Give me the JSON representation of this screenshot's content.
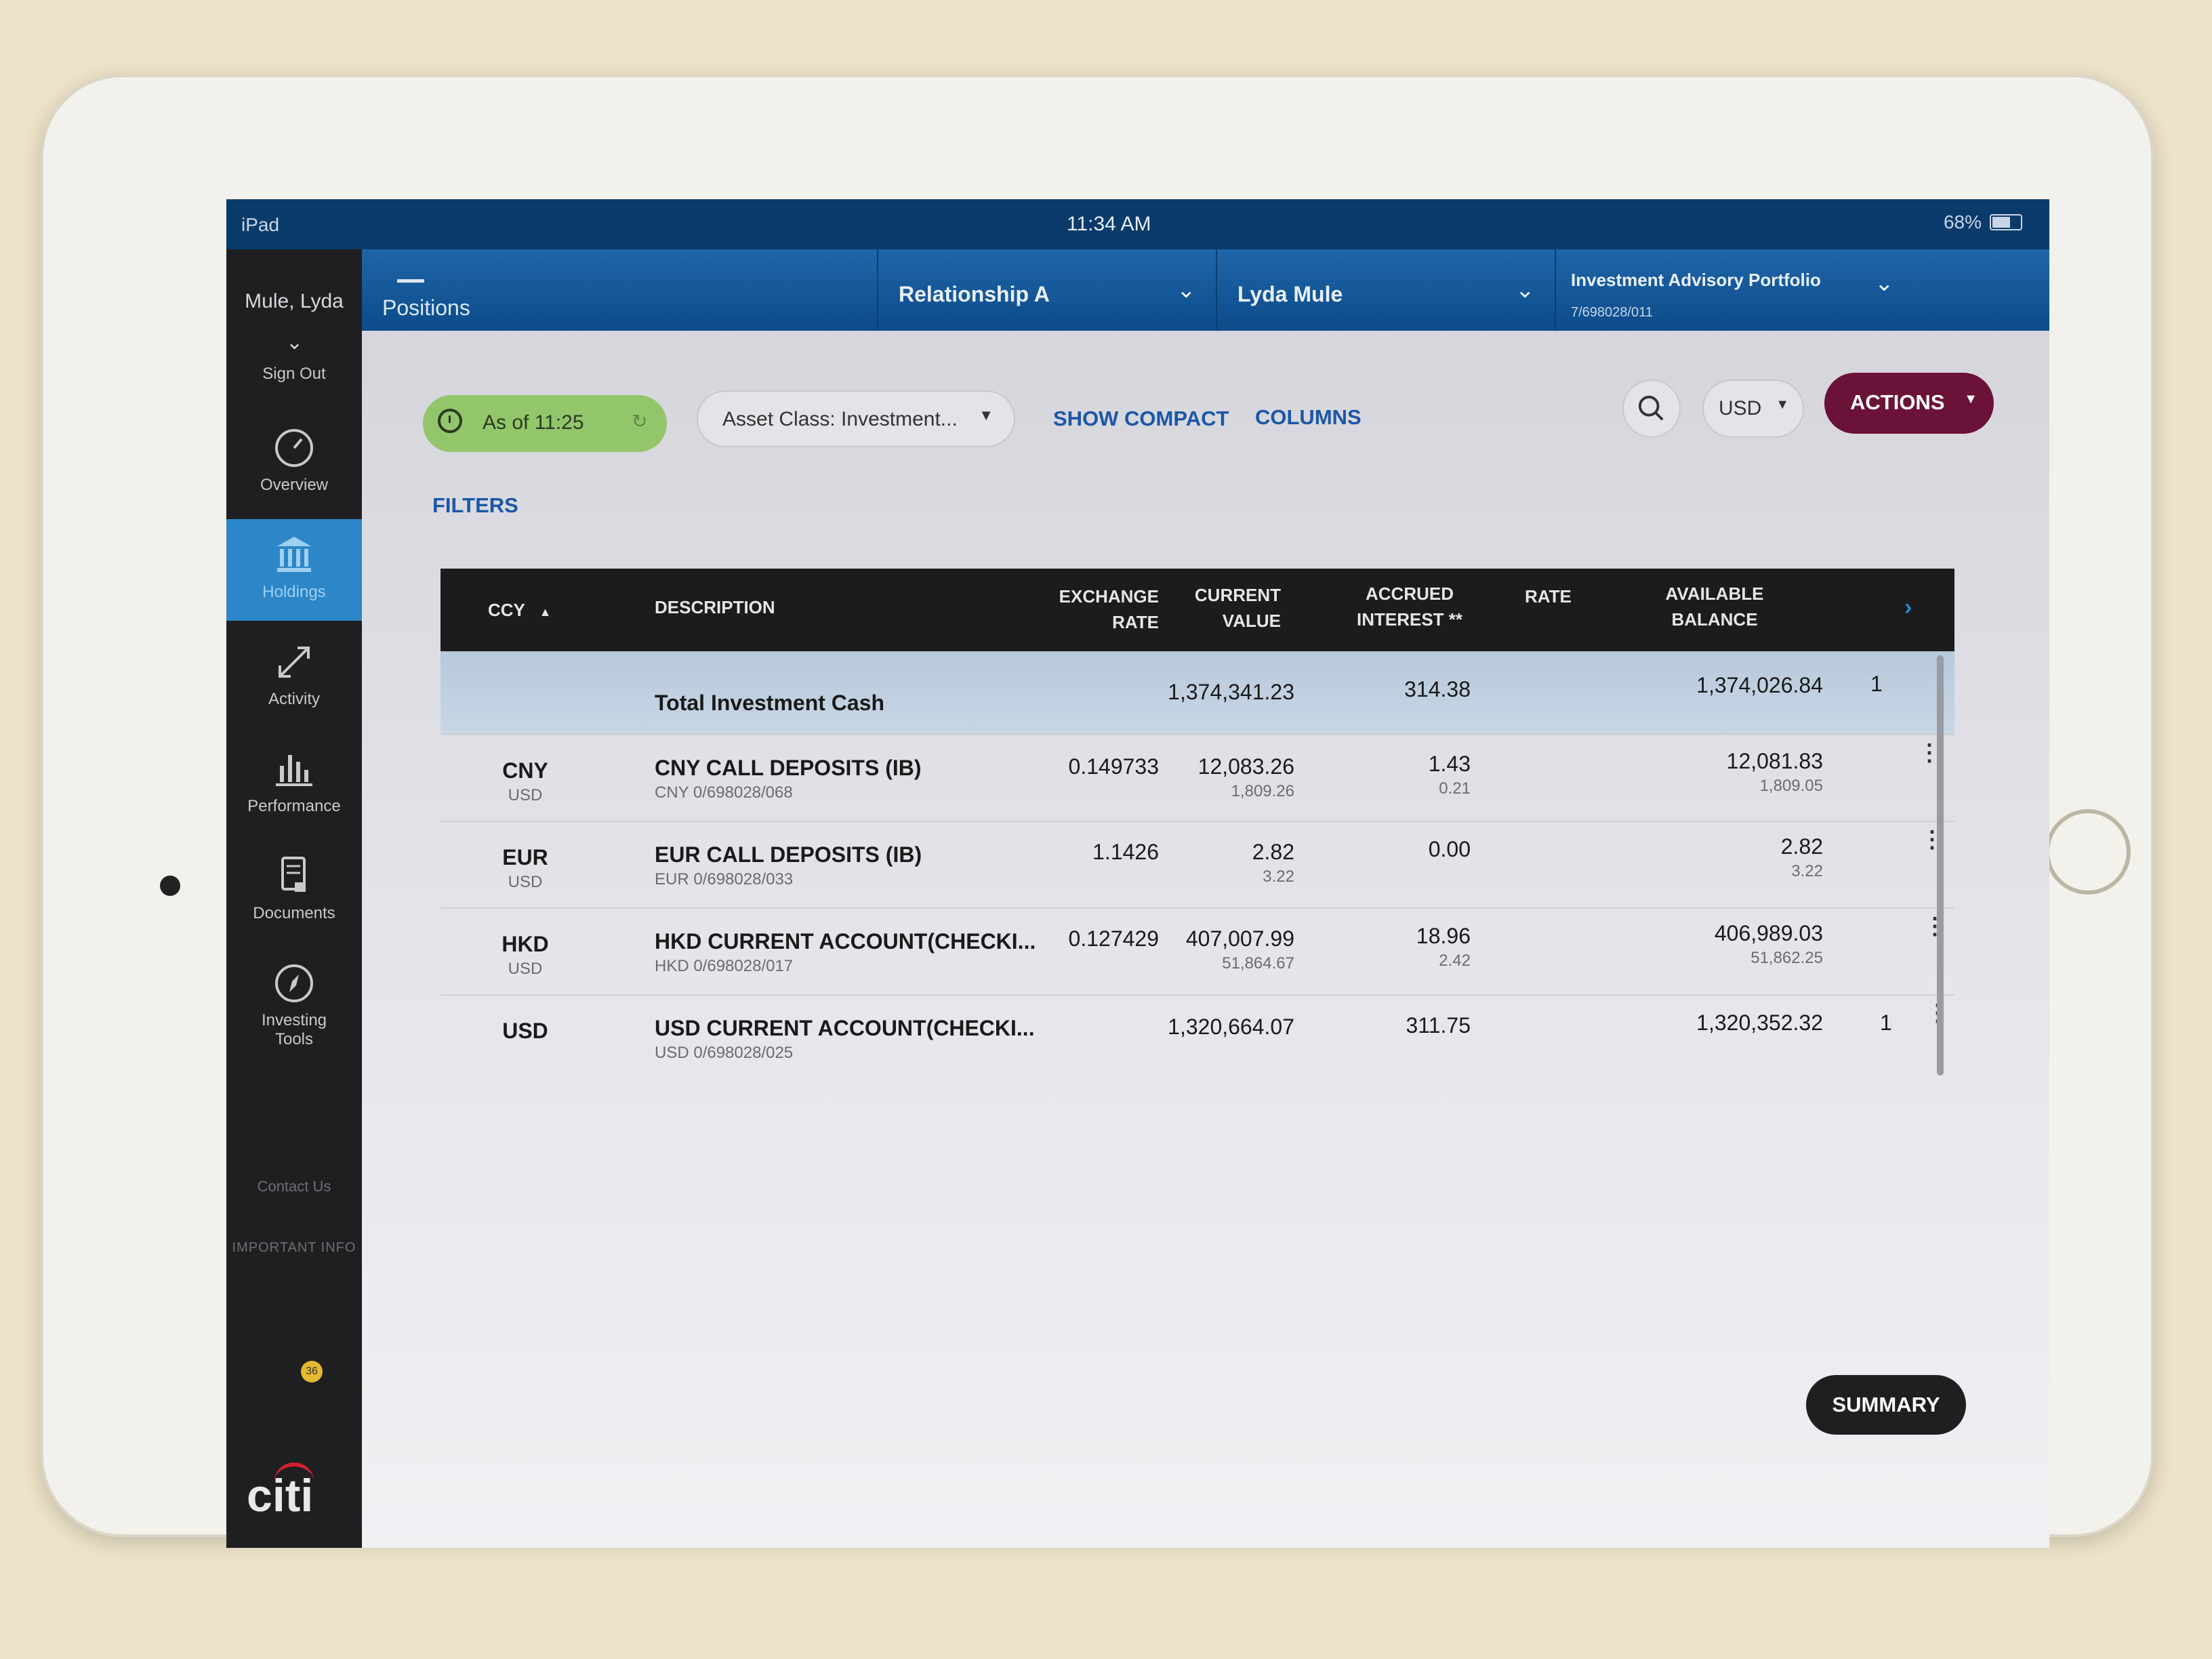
{
  "status_bar": {
    "device": "iPad",
    "time": "11:34 AM",
    "battery": "68%"
  },
  "sidebar": {
    "user_name": "Mule, Lyda",
    "sign_out": "Sign Out",
    "items": [
      {
        "label": "Overview",
        "icon": "gauge-icon"
      },
      {
        "label": "Holdings",
        "icon": "bank-icon"
      },
      {
        "label": "Activity",
        "icon": "arrows-diagonal-icon"
      },
      {
        "label": "Performance",
        "icon": "bar-chart-icon"
      },
      {
        "label": "Documents",
        "icon": "document-lock-icon"
      },
      {
        "label": "Investing Tools",
        "icon": "compass-icon"
      }
    ],
    "contact": "Contact Us",
    "important": "IMPORTANT INFO",
    "badge": "36",
    "logo": "citi"
  },
  "header": {
    "section": "Positions",
    "relationship": "Relationship A",
    "client": "Lyda  Mule",
    "portfolio": "Investment Advisory Portfolio",
    "portfolio_id": "7/698028/011"
  },
  "toolbar": {
    "as_of": "As of 11:25",
    "asset_class": "Asset Class: Investment...",
    "show_compact": "SHOW COMPACT",
    "columns": "COLUMNS",
    "filters": "FILTERS",
    "currency": "USD",
    "actions": "ACTIONS"
  },
  "table": {
    "headers": {
      "ccy": "CCY",
      "description": "DESCRIPTION",
      "exchange_rate_1": "EXCHANGE",
      "exchange_rate_2": "RATE",
      "current_value_1": "CURRENT",
      "current_value_2": "VALUE",
      "accrued_1": "ACCRUED",
      "accrued_2": "INTEREST **",
      "rate": "RATE",
      "available_1": "AVAILABLE",
      "available_2": "BALANCE"
    },
    "total": {
      "label": "Total Investment Cash",
      "current_value": "1,374,341.23",
      "accrued": "314.38",
      "available": "1,374,026.84",
      "extra": "1"
    },
    "rows": [
      {
        "ccy": "CNY",
        "ccy_sub": "USD",
        "desc": "CNY CALL DEPOSITS (IB)",
        "desc_sub": "CNY 0/698028/068",
        "exch": "0.149733",
        "cv": "12,083.26",
        "cv_sub": "1,809.26",
        "ai": "1.43",
        "ai_sub": "0.21",
        "ab": "12,081.83",
        "ab_sub": "1,809.05",
        "extra": ""
      },
      {
        "ccy": "EUR",
        "ccy_sub": "USD",
        "desc": "EUR CALL DEPOSITS (IB)",
        "desc_sub": "EUR 0/698028/033",
        "exch": "1.1426",
        "cv": "2.82",
        "cv_sub": "3.22",
        "ai": "0.00",
        "ai_sub": "",
        "ab": "2.82",
        "ab_sub": "3.22",
        "extra": ""
      },
      {
        "ccy": "HKD",
        "ccy_sub": "USD",
        "desc": "HKD CURRENT ACCOUNT(CHECKI...",
        "desc_sub": "HKD 0/698028/017",
        "exch": "0.127429",
        "cv": "407,007.99",
        "cv_sub": "51,864.67",
        "ai": "18.96",
        "ai_sub": "2.42",
        "ab": "406,989.03",
        "ab_sub": "51,862.25",
        "extra": ""
      },
      {
        "ccy": "USD",
        "ccy_sub": "",
        "desc": "USD CURRENT ACCOUNT(CHECKI...",
        "desc_sub": "USD 0/698028/025",
        "exch": "",
        "cv": "1,320,664.07",
        "cv_sub": "",
        "ai": "311.75",
        "ai_sub": "",
        "ab": "1,320,352.32",
        "ab_sub": "",
        "extra": "1"
      }
    ]
  },
  "summary": "SUMMARY",
  "colors": {
    "brand_blue": "#0d4b8a",
    "active_nav": "#2c86c7",
    "actions": "#6b1238",
    "as_of": "#93c66a",
    "link": "#1b57a6"
  }
}
